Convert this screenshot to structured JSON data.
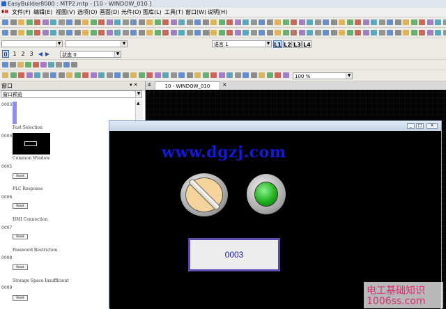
{
  "app": {
    "title": "EasyBuilder8000 : MTP2.mtp - [10 - WINDOW_010 ]"
  },
  "menu": {
    "logo": "EB",
    "items": [
      "文件(F)",
      "编辑(E)",
      "视图(V)",
      "选项(O)",
      "画面(D)",
      "元件(O)",
      "图库(L)",
      "工具(T)",
      "窗口(W)",
      "说明(H)"
    ]
  },
  "toolbar2": {
    "font_combo": "",
    "size_combo": "",
    "state_label": "语言 1",
    "lang_levels": [
      "L1",
      "L2",
      "L3",
      "L4"
    ]
  },
  "toolbar3": {
    "pages": [
      "0",
      "1",
      "2",
      "3"
    ],
    "state_combo": "状态 0"
  },
  "toolbar4": {
    "zoom": "100 %"
  },
  "panel": {
    "title": "窗口",
    "pin": "▾ ✕",
    "view_mode": "窗口预览",
    "entries": [
      {
        "num": "0003",
        "name": "Fast Selection"
      },
      {
        "num": "0004",
        "name": "Common Window"
      },
      {
        "num": "0005",
        "name": "PLC Response"
      },
      {
        "num": "0006",
        "name": "HMI Connection"
      },
      {
        "num": "0007",
        "name": "Password Restriction"
      },
      {
        "num": "0008",
        "name": "Storage Space Insufficient"
      },
      {
        "num": "0009",
        "name": ""
      }
    ],
    "thumb_btn": "Reset"
  },
  "tab": {
    "index": "4",
    "label": "10 - WINDOW_010",
    "close": "×"
  },
  "window": {
    "watermark": "www.dgzj.com",
    "numeric_display": "0003"
  },
  "brand": {
    "line1": "电工基础知识",
    "line2": "1006ss.com"
  },
  "colors": {
    "watermark": "#1418d8",
    "lamp_on": "#20b020",
    "display_border": "#5a4bb0",
    "brand": "#d4326e"
  }
}
